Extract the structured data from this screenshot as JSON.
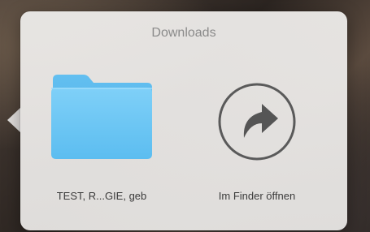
{
  "stack": {
    "title": "Downloads",
    "items": [
      {
        "label": "TEST, R...GIE, geb",
        "icon": "folder-icon",
        "color": "#5ab8ee"
      },
      {
        "label": "Im Finder öffnen",
        "icon": "open-in-finder-arrow-icon",
        "color": "#5a5a5a"
      }
    ]
  }
}
